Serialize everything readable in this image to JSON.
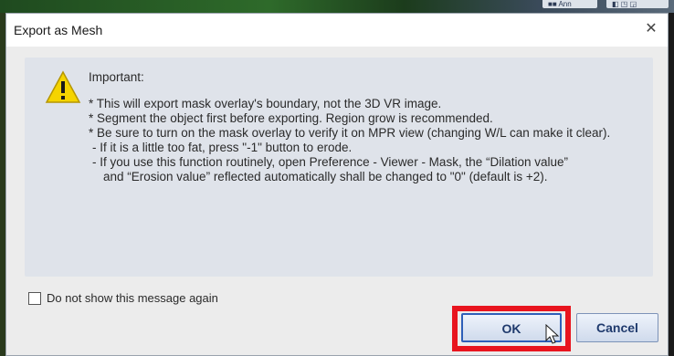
{
  "background": {
    "buttons": [
      "■■ Ann",
      "◧ ◳ ◲"
    ]
  },
  "dialog": {
    "title": "Export as Mesh",
    "close_glyph": "✕",
    "heading": "Important:",
    "lines": [
      "* This will export mask overlay's boundary, not the 3D VR image.",
      "* Segment the object first before exporting. Region grow is recommended.",
      "* Be sure to turn on the mask overlay to verify it on MPR view (changing W/L can make it clear).",
      "- If it is a little too fat, press \"-1\" button to erode.",
      "- If you use this function routinely, open Preference - Viewer - Mask, the “Dilation value”",
      "and “Erosion value” reflected automatically shall be changed to \"0\" (default is +2)."
    ],
    "checkbox_label": "Do not show this message again",
    "checkbox_checked": false,
    "ok_label": "OK",
    "cancel_label": "Cancel",
    "icon": "warning-icon",
    "highlight_color": "#e8141e"
  }
}
